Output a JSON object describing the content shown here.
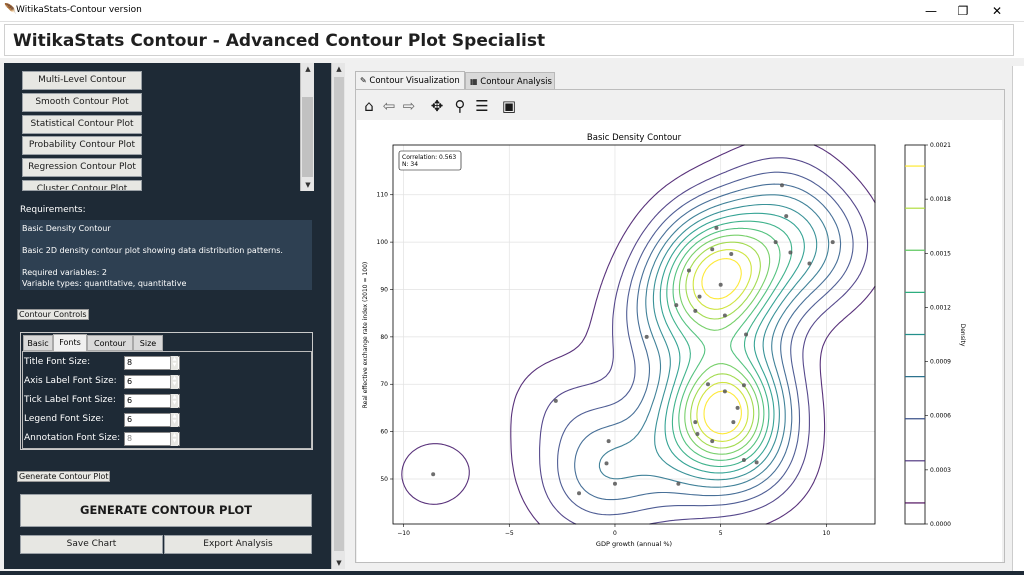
{
  "window": {
    "title": "WitikaStats-Contour version",
    "minimize": "—",
    "maximize": "❐",
    "close": "✕"
  },
  "header": {
    "title": "WitikaStats Contour - Advanced Contour Plot Specialist"
  },
  "sidebar": {
    "plot_types": [
      "Multi-Level Contour",
      "Smooth Contour Plot",
      "Statistical Contour Plot",
      "Probability Contour Plot",
      "Regression Contour Plot",
      "Cluster Contour Plot"
    ],
    "requirements_label": "Requirements:",
    "requirements": {
      "name": "Basic Density Contour",
      "description": "Basic 2D density contour plot showing data distribution patterns.",
      "required_vars": "Required variables: 2",
      "var_types": "Variable types: quantitative, quantitative"
    },
    "contour_controls_label": "Contour Controls",
    "control_tabs": [
      "Basic",
      "Fonts",
      "Contour",
      "Size"
    ],
    "active_tab": "Fonts",
    "font_settings": [
      {
        "label": "Title Font Size:",
        "value": "8"
      },
      {
        "label": "Axis Label Font Size:",
        "value": "6"
      },
      {
        "label": "Tick Label Font Size:",
        "value": "6"
      },
      {
        "label": "Legend Font Size:",
        "value": "6"
      },
      {
        "label": "Annotation Font Size:",
        "value": "8"
      }
    ],
    "generate_label": "Generate Contour Plot",
    "generate_button": "GENERATE CONTOUR PLOT",
    "save_button": "Save Chart",
    "export_button": "Export Analysis"
  },
  "notebook": {
    "tabs": [
      "Contour Visualization",
      "Contour Analysis"
    ],
    "active_tab": "Contour Visualization"
  },
  "toolbar_icons": [
    "home-icon",
    "back-icon",
    "forward-icon",
    "pan-icon",
    "zoom-icon",
    "configure-icon",
    "save-icon"
  ],
  "chart_data": {
    "type": "contour",
    "title": "Basic Density Contour",
    "xlabel": "GDP growth (annual %)",
    "ylabel": "Real effective exchange rate index (2010 = 100)",
    "xlim": [
      -10.5,
      12.3
    ],
    "ylim": [
      40.5,
      120.5
    ],
    "xticks": [
      -10,
      -5,
      0,
      5,
      10
    ],
    "xtick_labels": [
      "−10",
      "−5",
      "0",
      "5",
      "10"
    ],
    "yticks": [
      50,
      60,
      70,
      80,
      90,
      100,
      110
    ],
    "grid": true,
    "annotation": {
      "correlation": "Correlation: 0.563",
      "n": "N: 34"
    },
    "colorbar": {
      "label": "Density",
      "range": [
        0,
        0.0021
      ],
      "ticks": [
        "0.0000",
        "0.0003",
        "0.0006",
        "0.0009",
        "0.0012",
        "0.0015",
        "0.0018",
        "0.0021"
      ],
      "colormap": "viridis"
    },
    "points": [
      [
        -8.6,
        51
      ],
      [
        -2.8,
        66.5
      ],
      [
        -1.7,
        47
      ],
      [
        -0.4,
        53.3
      ],
      [
        -0.3,
        58
      ],
      [
        0,
        49
      ],
      [
        1.5,
        80
      ],
      [
        2.9,
        86.7
      ],
      [
        3.0,
        49
      ],
      [
        3.5,
        94
      ],
      [
        3.8,
        85.5
      ],
      [
        3.8,
        62
      ],
      [
        3.9,
        59.5
      ],
      [
        4.0,
        88.5
      ],
      [
        4.4,
        70
      ],
      [
        4.6,
        58
      ],
      [
        4.6,
        98.5
      ],
      [
        4.8,
        103
      ],
      [
        5.0,
        91
      ],
      [
        5.2,
        68.5
      ],
      [
        5.2,
        84.5
      ],
      [
        5.5,
        97.5
      ],
      [
        5.6,
        62
      ],
      [
        5.8,
        65
      ],
      [
        6.1,
        54
      ],
      [
        6.2,
        80.5
      ],
      [
        6.7,
        53.5
      ],
      [
        7.6,
        100
      ],
      [
        7.9,
        112
      ],
      [
        8.1,
        105.5
      ],
      [
        8.3,
        97.8
      ],
      [
        9.2,
        95.5
      ],
      [
        10.3,
        100
      ],
      [
        6.1,
        69.8
      ]
    ],
    "density_peaks": [
      {
        "x": 5.3,
        "y": 93,
        "sx": 1.8,
        "sy": 7.5
      },
      {
        "x": 5.2,
        "y": 64.5,
        "sx": 1.6,
        "sy": 7.0
      }
    ]
  }
}
